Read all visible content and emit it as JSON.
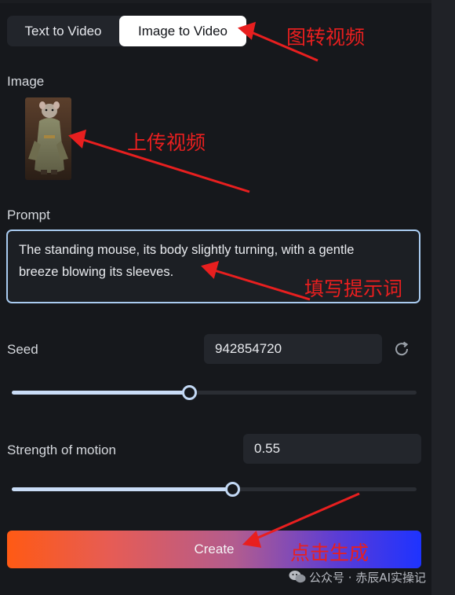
{
  "tabs": [
    {
      "label": "Text to Video",
      "active": false
    },
    {
      "label": "Image to Video",
      "active": true
    }
  ],
  "image_section": {
    "label": "Image",
    "thumbnail_icon": "mouse-in-robe-image"
  },
  "prompt": {
    "label": "Prompt",
    "value": "The standing mouse, its body slightly turning, with a gentle breeze blowing its sleeves."
  },
  "seed": {
    "label": "Seed",
    "value": "942854720",
    "slider_fraction": 0.45,
    "refresh_icon": "refresh-icon"
  },
  "motion": {
    "label": "Strength of motion",
    "value": "0.55",
    "slider_fraction": 0.55
  },
  "create_button": {
    "label": "Create"
  },
  "annotations": {
    "tab_note": "图转视频",
    "image_note": "上传视频",
    "prompt_note": "填写提示词",
    "create_note": "点击生成"
  },
  "watermark": {
    "text": "公众号 · 赤辰AI实操记",
    "icon": "wechat-icon"
  },
  "colors": {
    "accent_border": "#a9cbf0",
    "annotation_red": "#e81f1f",
    "gradient_start": "#ff5a14",
    "gradient_end": "#1e33ff"
  }
}
